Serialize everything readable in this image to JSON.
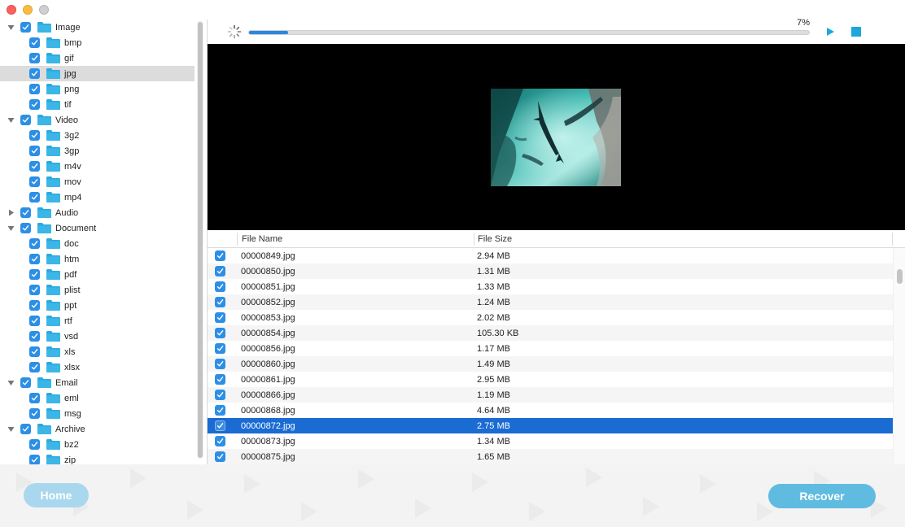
{
  "window": {
    "title": ""
  },
  "sidebar": {
    "tree": [
      {
        "label": "Image",
        "level": 0,
        "expanded": true,
        "checked": true
      },
      {
        "label": "bmp",
        "level": 1,
        "checked": true
      },
      {
        "label": "gif",
        "level": 1,
        "checked": true
      },
      {
        "label": "jpg",
        "level": 1,
        "checked": true,
        "selected": true
      },
      {
        "label": "png",
        "level": 1,
        "checked": true
      },
      {
        "label": "tif",
        "level": 1,
        "checked": true
      },
      {
        "label": "Video",
        "level": 0,
        "expanded": true,
        "checked": true
      },
      {
        "label": "3g2",
        "level": 1,
        "checked": true
      },
      {
        "label": "3gp",
        "level": 1,
        "checked": true
      },
      {
        "label": "m4v",
        "level": 1,
        "checked": true
      },
      {
        "label": "mov",
        "level": 1,
        "checked": true
      },
      {
        "label": "mp4",
        "level": 1,
        "checked": true
      },
      {
        "label": "Audio",
        "level": 0,
        "expanded": false,
        "checked": true
      },
      {
        "label": "Document",
        "level": 0,
        "expanded": true,
        "checked": true
      },
      {
        "label": "doc",
        "level": 1,
        "checked": true
      },
      {
        "label": "htm",
        "level": 1,
        "checked": true
      },
      {
        "label": "pdf",
        "level": 1,
        "checked": true
      },
      {
        "label": "plist",
        "level": 1,
        "checked": true
      },
      {
        "label": "ppt",
        "level": 1,
        "checked": true
      },
      {
        "label": "rtf",
        "level": 1,
        "checked": true
      },
      {
        "label": "vsd",
        "level": 1,
        "checked": true
      },
      {
        "label": "xls",
        "level": 1,
        "checked": true
      },
      {
        "label": "xlsx",
        "level": 1,
        "checked": true
      },
      {
        "label": "Email",
        "level": 0,
        "expanded": true,
        "checked": true
      },
      {
        "label": "eml",
        "level": 1,
        "checked": true
      },
      {
        "label": "msg",
        "level": 1,
        "checked": true
      },
      {
        "label": "Archive",
        "level": 0,
        "expanded": true,
        "checked": true
      },
      {
        "label": "bz2",
        "level": 1,
        "checked": true
      },
      {
        "label": "zip",
        "level": 1,
        "checked": true
      }
    ]
  },
  "toolbar": {
    "progress_text": "7%",
    "progress_fraction": 0.07,
    "play_icon": "play-icon",
    "stop_icon": "stop-icon"
  },
  "table": {
    "headers": {
      "name": "File Name",
      "size": "File Size"
    },
    "rows": [
      {
        "name": "00000849.jpg",
        "size": "2.94 MB",
        "checked": true
      },
      {
        "name": "00000850.jpg",
        "size": "1.31 MB",
        "checked": true
      },
      {
        "name": "00000851.jpg",
        "size": "1.33 MB",
        "checked": true
      },
      {
        "name": "00000852.jpg",
        "size": "1.24 MB",
        "checked": true
      },
      {
        "name": "00000853.jpg",
        "size": "2.02 MB",
        "checked": true
      },
      {
        "name": "00000854.jpg",
        "size": "105.30 KB",
        "checked": true
      },
      {
        "name": "00000856.jpg",
        "size": "1.17 MB",
        "checked": true
      },
      {
        "name": "00000860.jpg",
        "size": "1.49 MB",
        "checked": true
      },
      {
        "name": "00000861.jpg",
        "size": "2.95 MB",
        "checked": true
      },
      {
        "name": "00000866.jpg",
        "size": "1.19 MB",
        "checked": true
      },
      {
        "name": "00000868.jpg",
        "size": "4.64 MB",
        "checked": true
      },
      {
        "name": "00000872.jpg",
        "size": "2.75 MB",
        "checked": true,
        "selected": true
      },
      {
        "name": "00000873.jpg",
        "size": "1.34 MB",
        "checked": true
      },
      {
        "name": "00000875.jpg",
        "size": "1.65 MB",
        "checked": true
      }
    ]
  },
  "footer": {
    "home_label": "Home",
    "recover_label": "Recover"
  },
  "colors": {
    "accent": "#2c8fe6",
    "selection": "#1a6bd2",
    "folder": "#2aa9df",
    "button": "#5fbce0"
  }
}
